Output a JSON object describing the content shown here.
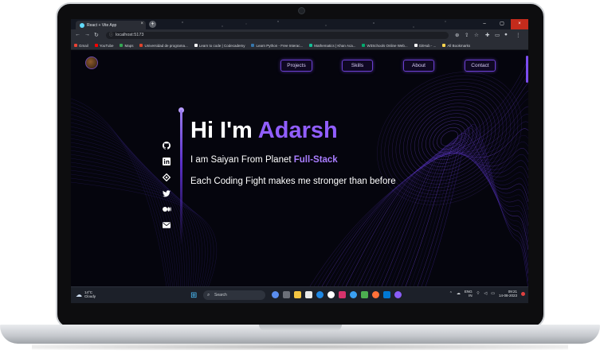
{
  "browser": {
    "tab_title": "React + Vite App",
    "url": "localhost:5173",
    "bookmarks": [
      {
        "label": "Gmail",
        "color": "#ea4335"
      },
      {
        "label": "YouTube",
        "color": "#ff0000"
      },
      {
        "label": "Maps",
        "color": "#34a853"
      },
      {
        "label": "Universidad de programa...",
        "color": "#e0442b"
      },
      {
        "label": "Learn to code | Codecademy",
        "color": "#ffffff"
      },
      {
        "label": "Learn Python - Free Interac...",
        "color": "#3776ab"
      },
      {
        "label": "Mathematics | Khan Aca...",
        "color": "#14bf96"
      },
      {
        "label": "W3Schools Online Web...",
        "color": "#04aa6d"
      },
      {
        "label": "GitHub - ...",
        "color": "#ffffff"
      },
      {
        "label": "All Bookmarks",
        "color": "#ffd54f"
      }
    ]
  },
  "nav": {
    "items": [
      "Projects",
      "Skills",
      "About",
      "Contact"
    ]
  },
  "socials": [
    "github-icon",
    "linkedin-icon",
    "hashnode-icon",
    "twitter-icon",
    "medium-icon",
    "mail-icon"
  ],
  "hero": {
    "greeting": "Hi I'm ",
    "name": "Adarsh",
    "sub_prefix": "I am Saiyan From Planet ",
    "sub_accent": "Full-Stack",
    "tagline": "Each Coding Fight makes me stronger than before"
  },
  "taskbar": {
    "weather_temp": "14°C",
    "weather_desc": "Cloudy",
    "search_placeholder": "Search",
    "lang_line1": "ENG",
    "lang_line2": "IN",
    "time": "09:21",
    "date": "14-08-2023"
  },
  "colors": {
    "accent": "#915eff",
    "background": "#05050d"
  }
}
